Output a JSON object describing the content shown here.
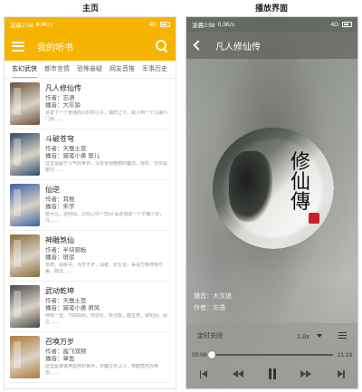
{
  "captions": {
    "left": "主页",
    "right": "播放界面"
  },
  "left": {
    "status": {
      "time": "凌晨2:58",
      "speed": "4.9K/s",
      "network": "4G"
    },
    "app_title": "我的听书",
    "tabs": [
      "玄幻武侠",
      "都市言情",
      "恐怖悬疑",
      "网友音推",
      "军事历史"
    ],
    "books": [
      {
        "title": "凡人修仙传",
        "author": "作者：忘语",
        "narrator": "播音：大灰狼",
        "desc": "讲述了一个普通的山村穷小子，偶然之下，跨入到一个江湖小门派……",
        "color": "#6b4f3a"
      },
      {
        "title": "斗破苍穹",
        "author": "作者：天蚕土豆",
        "narrator": "播音：猎笔小勇 葵儿",
        "desc": "这里是属于斗气的世界，没有花俏艳丽的魔法，有的，仅仅是繁衍……",
        "color": "#2f4a6b"
      },
      {
        "title": "仙逆",
        "author": "作者：耳根",
        "narrator": "播音：朱宇",
        "desc": "顺为凡，逆则仙，只在心中一念间 仙逆讲述一个平庸少年，凡……",
        "color": "#3b5fa8"
      },
      {
        "title": "神雕煞仙",
        "author": "作者：半块铜板",
        "narrator": "播音：斑驳",
        "desc": "苦修，战争中，为天不平，仙者，长生也，事关万族修炼与每，除去……",
        "color": "#8a6a3a"
      },
      {
        "title": "武动乾坤",
        "author": "作者：天蚕土豆",
        "narrator": "播音：猎笔小勇 君风",
        "desc": "修炼一途，乃窃阴阳，夺造化，转涅槃，握生死，掌轮回。武之……",
        "color": "#4a4a4a"
      },
      {
        "title": "召唤万岁",
        "author": "作者：霞飞双颊",
        "narrator": "播音：章鱼",
        "desc": "这里是被诸神遗弃的世界，天魔冷无斗斗，穿越竟然召唤兽……",
        "color": "#b07a3a"
      }
    ]
  },
  "right": {
    "status": {
      "time": "凌晨2:58",
      "speed": "0.3K/s",
      "network": "4G"
    },
    "title": "凡人修仙传",
    "narrator_line": "播音：大灰狼",
    "author_line": "作者：忘语",
    "timer_label": "定时关闭",
    "speed_value": "1.0x",
    "time_current": "00:08",
    "time_total": "21:19",
    "progress": 0.006,
    "disc_text": "修仙傳",
    "icons": [
      "back-icon",
      "chevron-down-icon",
      "playlist-icon",
      "skip-previous-icon",
      "rewind-icon",
      "pause-icon",
      "fast-forward-icon",
      "skip-next-icon"
    ]
  }
}
